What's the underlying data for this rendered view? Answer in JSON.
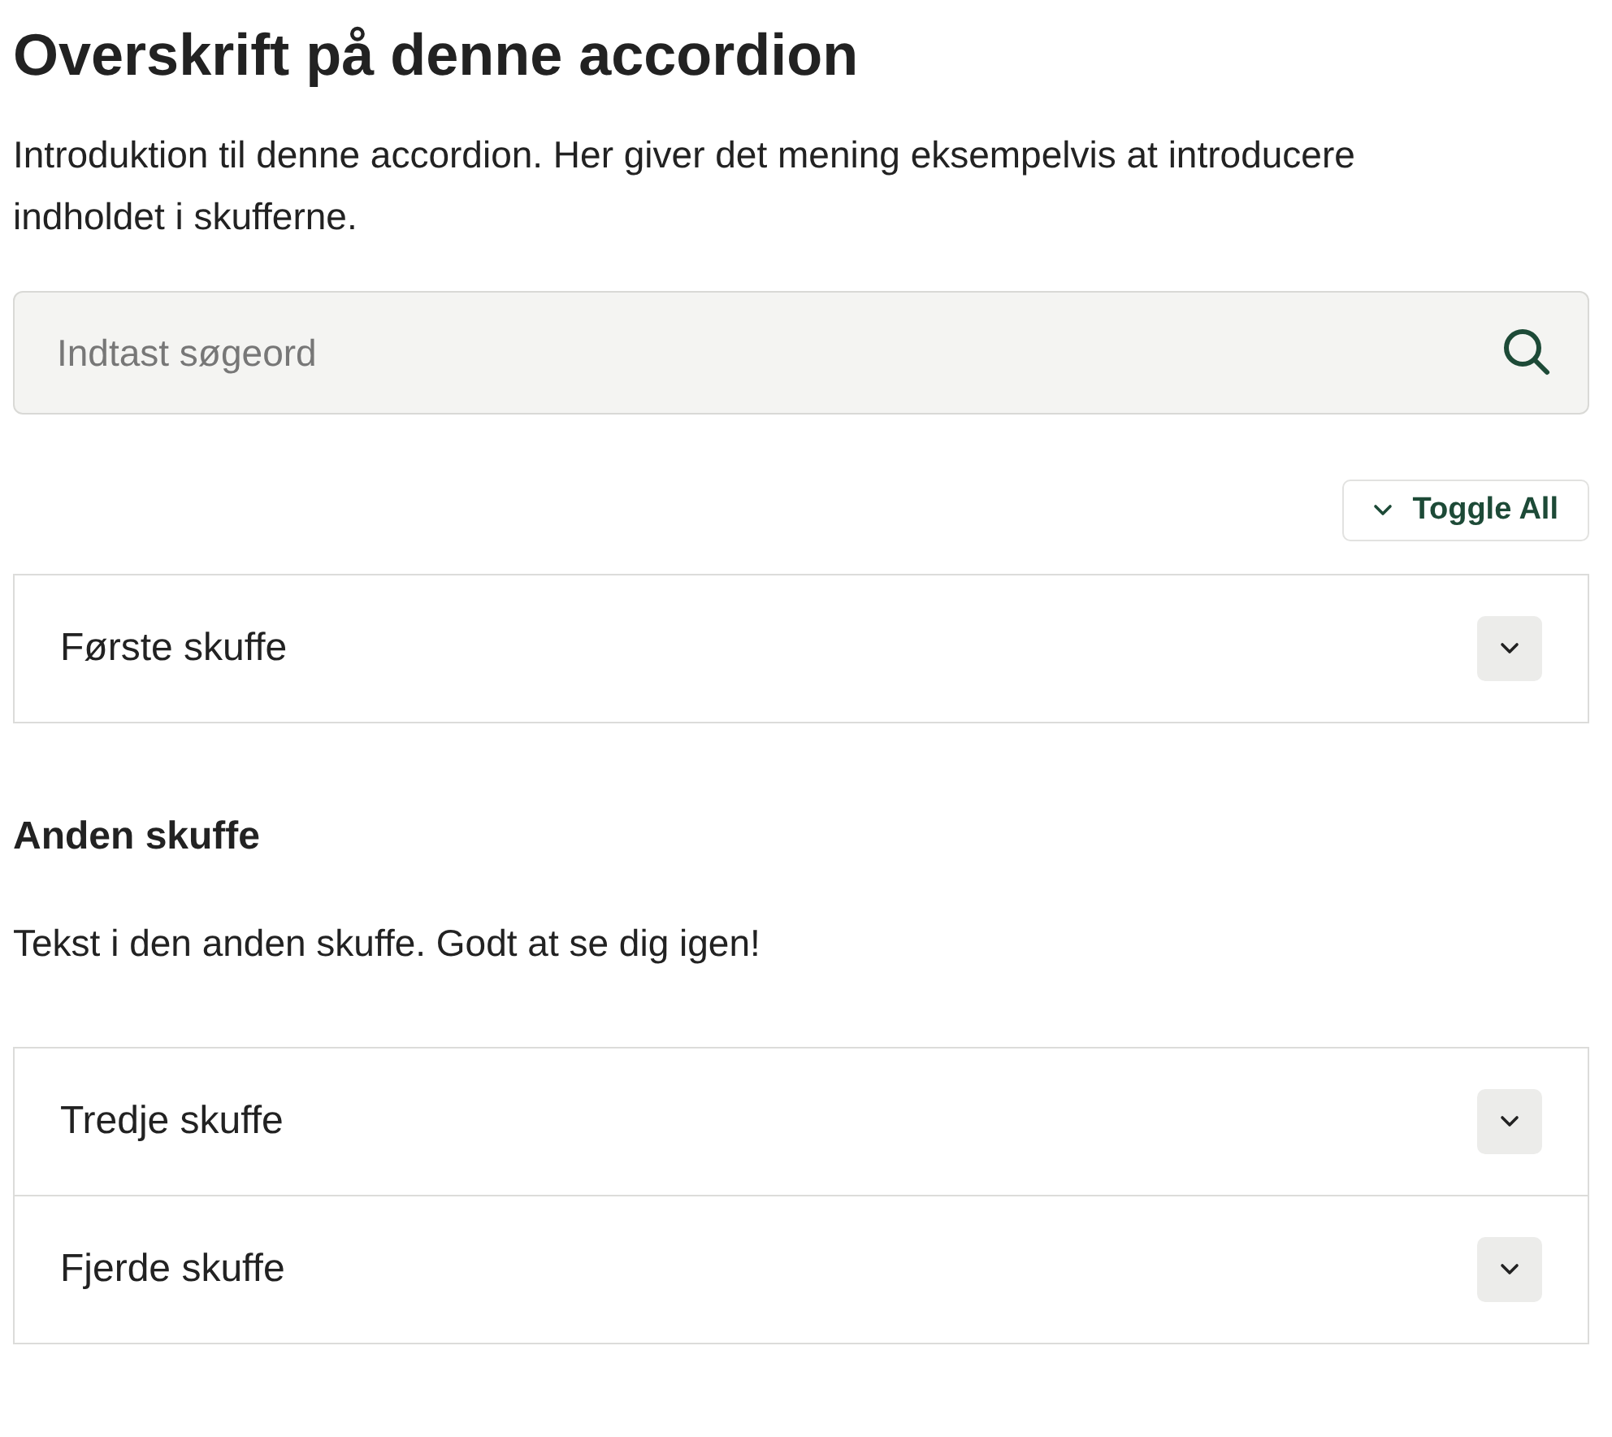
{
  "heading": "Overskrift på denne accordion",
  "intro": "Introduktion til denne accordion. Her giver det mening eksempelvis at introducere indholdet i skufferne.",
  "search": {
    "placeholder": "Indtast søgeord"
  },
  "toggle_all": "Toggle All",
  "drawers": [
    {
      "title": "Første skuffe",
      "expanded": false
    },
    {
      "title": "Anden skuffe",
      "expanded": true,
      "body": "Tekst i den anden skuffe. Godt at se dig igen!"
    },
    {
      "title": "Tredje skuffe",
      "expanded": false
    },
    {
      "title": "Fjerde skuffe",
      "expanded": false
    }
  ]
}
